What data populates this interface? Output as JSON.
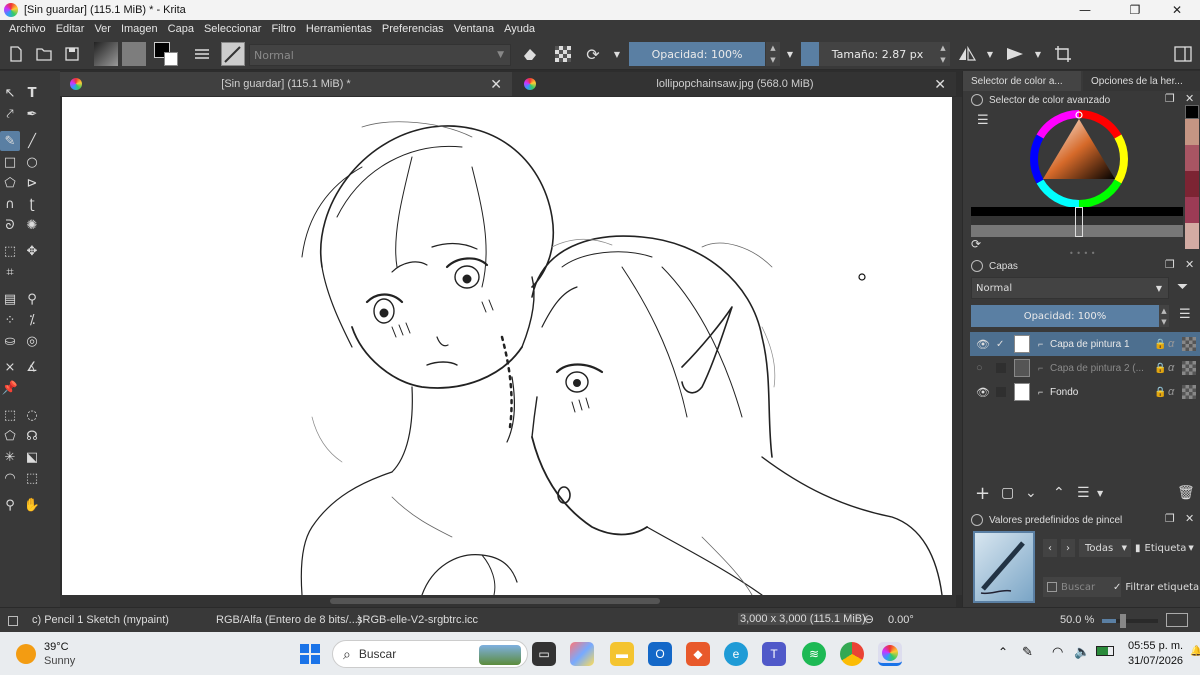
{
  "window": {
    "title": "[Sin guardar]  (115.1 MiB) * - Krita",
    "controls": [
      "—",
      "❐",
      "✕"
    ]
  },
  "menu": [
    "Archivo",
    "Editar",
    "Ver",
    "Imagen",
    "Capa",
    "Seleccionar",
    "Filtro",
    "Herramientas",
    "Preferencias",
    "Ventana",
    "Ayuda"
  ],
  "toolbar": {
    "blend_mode": "Normal",
    "opacity": "Opacidad: 100%",
    "size": "Tamaño: 2.87 px"
  },
  "tabs": [
    {
      "title": "[Sin guardar]  (115.1 MiB) *",
      "close": "✕"
    },
    {
      "title": "lollipopchainsaw.jpg (568.0 MiB)",
      "close": "✕"
    }
  ],
  "dock": {
    "tabs": [
      "Selector de color a...",
      "Opciones de la her..."
    ],
    "color_panel_title": "Selector de color avanzado",
    "layers_panel_title": "Capas",
    "layer_blend": "Normal",
    "layer_opacity": "Opacidad:  100%",
    "layers": [
      {
        "name": "Capa de pintura 1",
        "visible": true,
        "selected": true
      },
      {
        "name": "Capa de pintura 2 (...",
        "visible": false,
        "selected": false
      },
      {
        "name": "Fondo",
        "visible": true,
        "selected": false
      }
    ],
    "brush_panel_title": "Valores predefinidos de pincel",
    "brush_tag_all": "Todas",
    "brush_tag": "Etiqueta",
    "brush_search": "Buscar",
    "brush_filter": "Filtrar etiqueta"
  },
  "status": {
    "brush": "c) Pencil 1 Sketch (mypaint)",
    "colorspace": "RGB/Alfa (Entero de 8 bits/...)",
    "profile": "sRGB-elle-V2-srgbtrc.icc",
    "dimensions": "3,000 x 3,000 (115.1 MiB)",
    "rotation": "0.00°",
    "zoom": "50.0 %"
  },
  "taskbar": {
    "temperature": "39°C",
    "weather": "Sunny",
    "search": "Buscar",
    "time": "05:55 p. m.",
    "date": "31/07/2026"
  }
}
